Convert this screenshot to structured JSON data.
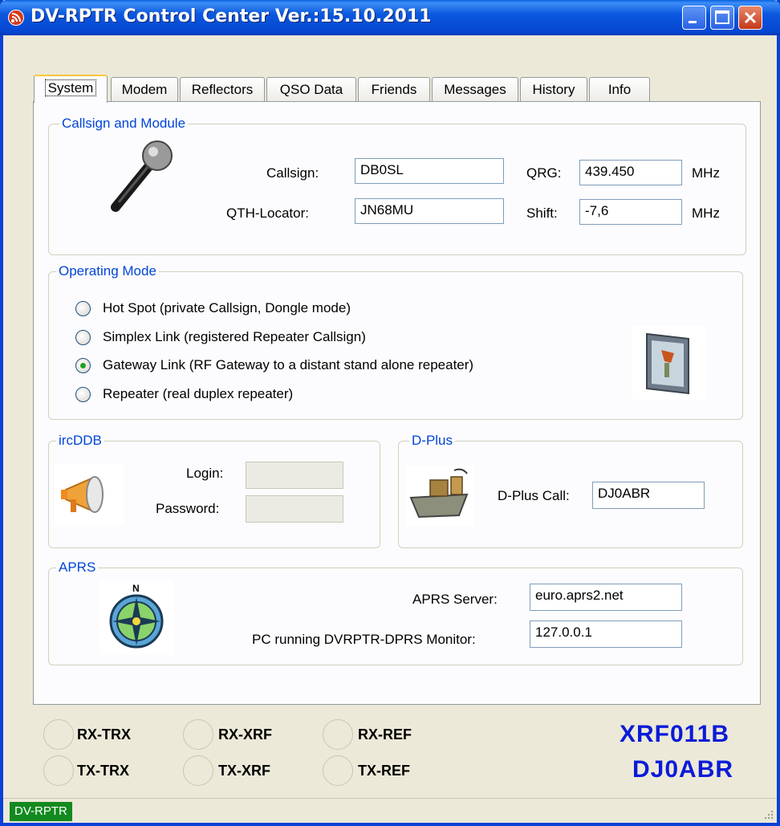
{
  "window": {
    "title": "DV-RPTR Control Center Ver.:15.10.2011"
  },
  "tabs": [
    "System",
    "Modem",
    "Reflectors",
    "QSO Data",
    "Friends",
    "Messages",
    "History",
    "Info"
  ],
  "callsign_module": {
    "legend": "Callsign and Module",
    "callsign_label": "Callsign:",
    "callsign_value": "DB0SL",
    "qth_label": "QTH-Locator:",
    "qth_value": "JN68MU",
    "qrg_label": "QRG:",
    "qrg_value": "439.450",
    "qrg_unit": "MHz",
    "shift_label": "Shift:",
    "shift_value": "-7,6",
    "shift_unit": "MHz",
    "icon": "microphone-icon"
  },
  "operating_mode": {
    "legend": "Operating Mode",
    "options": [
      "Hot Spot (private Callsign, Dongle mode)",
      "Simplex Link (registered Repeater Callsign)",
      "Gateway Link (RF Gateway to a distant stand alone repeater)",
      "Repeater (real duplex repeater)"
    ],
    "selected_index": 2,
    "icon": "repeater-device-icon"
  },
  "ircddb": {
    "legend": "ircDDB",
    "login_label": "Login:",
    "login_value": "",
    "password_label": "Password:",
    "password_value": "",
    "icon": "megaphone-icon"
  },
  "dplus": {
    "legend": "D-Plus",
    "call_label": "D-Plus Call:",
    "call_value": "DJ0ABR",
    "icon": "ship-icon"
  },
  "aprs": {
    "legend": "APRS",
    "server_label": "APRS Server:",
    "server_value": "euro.aprs2.net",
    "monitor_label": "PC running DVRPTR-DPRS Monitor:",
    "monitor_value": "127.0.0.1",
    "icon": "compass-icon"
  },
  "indicators": {
    "rx_trx": "RX-TRX",
    "rx_xrf": "RX-XRF",
    "rx_ref": "RX-REF",
    "tx_trx": "TX-TRX",
    "tx_xrf": "TX-XRF",
    "tx_ref": "TX-REF"
  },
  "link": {
    "reflector": "XRF011B",
    "callsign": "DJ0ABR"
  },
  "statusbar": {
    "text": "DV-RPTR"
  },
  "colors": {
    "title_bar": "#0A5FE0",
    "legend": "#0046D5",
    "link_text": "#0A1BD8",
    "status_panel": "#128A1F",
    "radio_dot": "#21A121"
  }
}
